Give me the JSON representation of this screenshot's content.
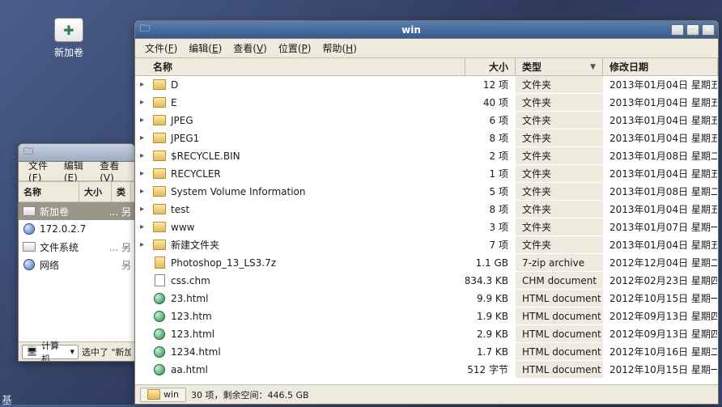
{
  "desktop": {
    "volume_label": "新加卷"
  },
  "compWin": {
    "title": "",
    "menus": [
      "文件(F)",
      "编辑(E)",
      "查看(V)"
    ],
    "headers": [
      "名称",
      "大小",
      "类"
    ],
    "items": [
      {
        "label": "新加卷",
        "icon": "drive",
        "tail": "... 另",
        "selected": true
      },
      {
        "label": "172.0.2.7",
        "icon": "net",
        "tail": ""
      },
      {
        "label": "文件系统",
        "icon": "sys",
        "tail": "... 另"
      },
      {
        "label": "网络",
        "icon": "net",
        "tail": "另"
      }
    ],
    "combo": {
      "icon": "comp",
      "label": "计算机",
      "arrow": "▾"
    },
    "status": "选中了 \"新加"
  },
  "mainWin": {
    "title": "win",
    "menus": [
      "文件(F)",
      "编辑(E)",
      "查看(V)",
      "位置(P)",
      "帮助(H)"
    ],
    "columns": {
      "name": "名称",
      "size": "大小",
      "type": "类型",
      "date": "修改日期"
    },
    "rows": [
      {
        "exp": true,
        "icon": "folder",
        "name": "D",
        "size": "12 项",
        "type": "文件夹",
        "date": "2013年01月04日 星期五"
      },
      {
        "exp": true,
        "icon": "folder",
        "name": "E",
        "size": "40 项",
        "type": "文件夹",
        "date": "2013年01月04日 星期五"
      },
      {
        "exp": true,
        "icon": "folder",
        "name": "JPEG",
        "size": "6 项",
        "type": "文件夹",
        "date": "2013年01月04日 星期五"
      },
      {
        "exp": true,
        "icon": "folder",
        "name": "JPEG1",
        "size": "8 项",
        "type": "文件夹",
        "date": "2013年01月04日 星期五"
      },
      {
        "exp": true,
        "icon": "folder",
        "name": "$RECYCLE.BIN",
        "size": "2 项",
        "type": "文件夹",
        "date": "2013年01月08日 星期二"
      },
      {
        "exp": true,
        "icon": "folder",
        "name": "RECYCLER",
        "size": "1 项",
        "type": "文件夹",
        "date": "2013年01月04日 星期五"
      },
      {
        "exp": true,
        "icon": "folder",
        "name": "System Volume Information",
        "size": "5 项",
        "type": "文件夹",
        "date": "2013年01月08日 星期二"
      },
      {
        "exp": true,
        "icon": "folder",
        "name": "test",
        "size": "8 项",
        "type": "文件夹",
        "date": "2013年01月04日 星期五"
      },
      {
        "exp": true,
        "icon": "folder",
        "name": "www",
        "size": "3 项",
        "type": "文件夹",
        "date": "2013年01月07日 星期一"
      },
      {
        "exp": true,
        "icon": "folder",
        "name": "新建文件夹",
        "size": "7 项",
        "type": "文件夹",
        "date": "2013年01月04日 星期五"
      },
      {
        "exp": false,
        "icon": "zip",
        "name": "Photoshop_13_LS3.7z",
        "size": "1.1 GB",
        "type": "7-zip archive",
        "date": "2012年12月04日 星期二"
      },
      {
        "exp": false,
        "icon": "chm",
        "name": "css.chm",
        "size": "834.3 KB",
        "type": "CHM document",
        "date": "2012年02月23日 星期四"
      },
      {
        "exp": false,
        "icon": "html",
        "name": "23.html",
        "size": "9.9 KB",
        "type": "HTML document",
        "date": "2012年10月15日 星期一"
      },
      {
        "exp": false,
        "icon": "html",
        "name": "123.htm",
        "size": "1.9 KB",
        "type": "HTML document",
        "date": "2012年09月13日 星期四"
      },
      {
        "exp": false,
        "icon": "html",
        "name": "123.html",
        "size": "2.9 KB",
        "type": "HTML document",
        "date": "2012年09月13日 星期四"
      },
      {
        "exp": false,
        "icon": "html",
        "name": "1234.html",
        "size": "1.7 KB",
        "type": "HTML document",
        "date": "2012年10月16日 星期二"
      },
      {
        "exp": false,
        "icon": "html",
        "name": "aa.html",
        "size": "512 字节",
        "type": "HTML document",
        "date": "2012年10月15日 星期一"
      }
    ],
    "crumb": "win",
    "status": "30 项，剩余空间：446.5 GB"
  },
  "footer": "基"
}
